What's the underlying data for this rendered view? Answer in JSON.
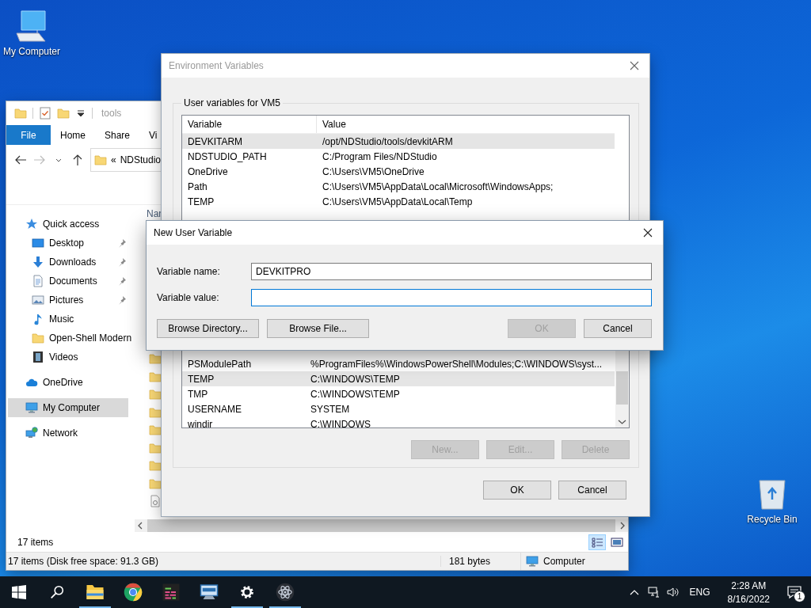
{
  "desktop_icons": [
    {
      "kind": "computer",
      "label": "My Computer"
    },
    {
      "kind": "recycle-bin",
      "label": "Recycle Bin"
    }
  ],
  "explorer": {
    "title": "tools",
    "ribbon_tabs": [
      {
        "label": "File",
        "selected": true
      },
      {
        "label": "Home",
        "selected": false
      },
      {
        "label": "Share",
        "selected": false
      },
      {
        "label": "Vi",
        "selected": false
      }
    ],
    "address": {
      "overflow": "«",
      "crumb": "NDStudio"
    },
    "column_header": "Nar",
    "nav": [
      {
        "kind": "star",
        "label": "Quick access",
        "selected": false,
        "children": [
          {
            "kind": "desktop",
            "label": "Desktop",
            "pinned": true,
            "selected": false
          },
          {
            "kind": "downloads",
            "label": "Downloads",
            "pinned": true,
            "selected": false
          },
          {
            "kind": "documents",
            "label": "Documents",
            "pinned": true,
            "selected": false
          },
          {
            "kind": "pictures",
            "label": "Pictures",
            "pinned": true,
            "selected": false
          },
          {
            "kind": "music",
            "label": "Music",
            "pinned": false,
            "selected": false
          },
          {
            "kind": "folder",
            "label": "Open-Shell Modern",
            "pinned": false,
            "selected": false
          },
          {
            "kind": "videos",
            "label": "Videos",
            "pinned": false,
            "selected": false
          }
        ]
      },
      {
        "kind": "cloud",
        "label": "OneDrive",
        "selected": false
      },
      {
        "kind": "computer",
        "label": "My Computer",
        "selected": true
      },
      {
        "kind": "network",
        "label": "Network",
        "selected": false
      }
    ],
    "item_count": "17 items",
    "view_buttons": [
      {
        "kind": "details",
        "selected": true
      },
      {
        "kind": "large-icons",
        "selected": false
      }
    ],
    "status_bar": {
      "summary": "17 items (Disk free space: 91.3 GB)",
      "size": "181 bytes",
      "location": "Computer"
    }
  },
  "environment_variables": {
    "title": "Environment Variables",
    "user_group": "User variables for VM5",
    "columns": [
      "Variable",
      "Value"
    ],
    "user_rows": [
      {
        "variable": "DEVKITARM",
        "value": "/opt/NDStudio/tools/devkitARM",
        "selected": true
      },
      {
        "variable": "NDSTUDIO_PATH",
        "value": "C:/Program Files/NDStudio",
        "selected": false
      },
      {
        "variable": "OneDrive",
        "value": "C:\\Users\\VM5\\OneDrive",
        "selected": false
      },
      {
        "variable": "Path",
        "value": "C:\\Users\\VM5\\AppData\\Local\\Microsoft\\WindowsApps;",
        "selected": false
      },
      {
        "variable": "TEMP",
        "value": "C:\\Users\\VM5\\AppData\\Local\\Temp",
        "selected": false
      }
    ],
    "system_rows": [
      {
        "variable": "PSModulePath",
        "value": "%ProgramFiles%\\WindowsPowerShell\\Modules;C:\\WINDOWS\\syst...",
        "selected": false
      },
      {
        "variable": "TEMP",
        "value": "C:\\WINDOWS\\TEMP",
        "selected": true
      },
      {
        "variable": "TMP",
        "value": "C:\\WINDOWS\\TEMP",
        "selected": false
      },
      {
        "variable": "USERNAME",
        "value": "SYSTEM",
        "selected": false
      },
      {
        "variable": "windir",
        "value": "C:\\WINDOWS",
        "selected": false
      }
    ],
    "system_buttons": [
      {
        "label": "New...",
        "disabled": true
      },
      {
        "label": "Edit...",
        "disabled": true
      },
      {
        "label": "Delete",
        "disabled": true
      }
    ],
    "buttons": [
      {
        "label": "OK",
        "disabled": false
      },
      {
        "label": "Cancel",
        "disabled": false
      }
    ]
  },
  "new_user_variable": {
    "title": "New User Variable",
    "fields": [
      {
        "label": "Variable name:",
        "value": "DEVKITPRO",
        "focused": false
      },
      {
        "label": "Variable value:",
        "focused": true
      }
    ],
    "left_buttons": [
      {
        "label": "Browse Directory...",
        "disabled": false
      },
      {
        "label": "Browse File...",
        "disabled": false
      }
    ],
    "right_buttons": [
      {
        "label": "OK",
        "disabled": true
      },
      {
        "label": "Cancel",
        "disabled": false
      }
    ]
  },
  "taskbar": {
    "items": [
      {
        "kind": "start",
        "running": false
      },
      {
        "kind": "search",
        "running": false
      },
      {
        "kind": "explorer",
        "running": true
      },
      {
        "kind": "chrome",
        "running": false
      },
      {
        "kind": "terminal",
        "running": false
      },
      {
        "kind": "computer",
        "running": false
      },
      {
        "kind": "settings",
        "running": true
      },
      {
        "kind": "atom",
        "running": true
      }
    ],
    "language": "ENG",
    "time": "2:28 AM",
    "date": "8/16/2022",
    "notification_count": "1"
  }
}
